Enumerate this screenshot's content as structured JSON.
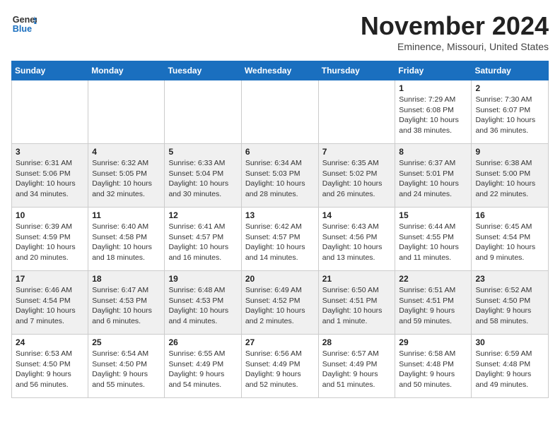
{
  "logo": {
    "line1": "General",
    "line2": "Blue"
  },
  "title": "November 2024",
  "location": "Eminence, Missouri, United States",
  "weekdays": [
    "Sunday",
    "Monday",
    "Tuesday",
    "Wednesday",
    "Thursday",
    "Friday",
    "Saturday"
  ],
  "weeks": [
    [
      {
        "day": "",
        "info": ""
      },
      {
        "day": "",
        "info": ""
      },
      {
        "day": "",
        "info": ""
      },
      {
        "day": "",
        "info": ""
      },
      {
        "day": "",
        "info": ""
      },
      {
        "day": "1",
        "info": "Sunrise: 7:29 AM\nSunset: 6:08 PM\nDaylight: 10 hours\nand 38 minutes."
      },
      {
        "day": "2",
        "info": "Sunrise: 7:30 AM\nSunset: 6:07 PM\nDaylight: 10 hours\nand 36 minutes."
      }
    ],
    [
      {
        "day": "3",
        "info": "Sunrise: 6:31 AM\nSunset: 5:06 PM\nDaylight: 10 hours\nand 34 minutes."
      },
      {
        "day": "4",
        "info": "Sunrise: 6:32 AM\nSunset: 5:05 PM\nDaylight: 10 hours\nand 32 minutes."
      },
      {
        "day": "5",
        "info": "Sunrise: 6:33 AM\nSunset: 5:04 PM\nDaylight: 10 hours\nand 30 minutes."
      },
      {
        "day": "6",
        "info": "Sunrise: 6:34 AM\nSunset: 5:03 PM\nDaylight: 10 hours\nand 28 minutes."
      },
      {
        "day": "7",
        "info": "Sunrise: 6:35 AM\nSunset: 5:02 PM\nDaylight: 10 hours\nand 26 minutes."
      },
      {
        "day": "8",
        "info": "Sunrise: 6:37 AM\nSunset: 5:01 PM\nDaylight: 10 hours\nand 24 minutes."
      },
      {
        "day": "9",
        "info": "Sunrise: 6:38 AM\nSunset: 5:00 PM\nDaylight: 10 hours\nand 22 minutes."
      }
    ],
    [
      {
        "day": "10",
        "info": "Sunrise: 6:39 AM\nSunset: 4:59 PM\nDaylight: 10 hours\nand 20 minutes."
      },
      {
        "day": "11",
        "info": "Sunrise: 6:40 AM\nSunset: 4:58 PM\nDaylight: 10 hours\nand 18 minutes."
      },
      {
        "day": "12",
        "info": "Sunrise: 6:41 AM\nSunset: 4:57 PM\nDaylight: 10 hours\nand 16 minutes."
      },
      {
        "day": "13",
        "info": "Sunrise: 6:42 AM\nSunset: 4:57 PM\nDaylight: 10 hours\nand 14 minutes."
      },
      {
        "day": "14",
        "info": "Sunrise: 6:43 AM\nSunset: 4:56 PM\nDaylight: 10 hours\nand 13 minutes."
      },
      {
        "day": "15",
        "info": "Sunrise: 6:44 AM\nSunset: 4:55 PM\nDaylight: 10 hours\nand 11 minutes."
      },
      {
        "day": "16",
        "info": "Sunrise: 6:45 AM\nSunset: 4:54 PM\nDaylight: 10 hours\nand 9 minutes."
      }
    ],
    [
      {
        "day": "17",
        "info": "Sunrise: 6:46 AM\nSunset: 4:54 PM\nDaylight: 10 hours\nand 7 minutes."
      },
      {
        "day": "18",
        "info": "Sunrise: 6:47 AM\nSunset: 4:53 PM\nDaylight: 10 hours\nand 6 minutes."
      },
      {
        "day": "19",
        "info": "Sunrise: 6:48 AM\nSunset: 4:53 PM\nDaylight: 10 hours\nand 4 minutes."
      },
      {
        "day": "20",
        "info": "Sunrise: 6:49 AM\nSunset: 4:52 PM\nDaylight: 10 hours\nand 2 minutes."
      },
      {
        "day": "21",
        "info": "Sunrise: 6:50 AM\nSunset: 4:51 PM\nDaylight: 10 hours\nand 1 minute."
      },
      {
        "day": "22",
        "info": "Sunrise: 6:51 AM\nSunset: 4:51 PM\nDaylight: 9 hours\nand 59 minutes."
      },
      {
        "day": "23",
        "info": "Sunrise: 6:52 AM\nSunset: 4:50 PM\nDaylight: 9 hours\nand 58 minutes."
      }
    ],
    [
      {
        "day": "24",
        "info": "Sunrise: 6:53 AM\nSunset: 4:50 PM\nDaylight: 9 hours\nand 56 minutes."
      },
      {
        "day": "25",
        "info": "Sunrise: 6:54 AM\nSunset: 4:50 PM\nDaylight: 9 hours\nand 55 minutes."
      },
      {
        "day": "26",
        "info": "Sunrise: 6:55 AM\nSunset: 4:49 PM\nDaylight: 9 hours\nand 54 minutes."
      },
      {
        "day": "27",
        "info": "Sunrise: 6:56 AM\nSunset: 4:49 PM\nDaylight: 9 hours\nand 52 minutes."
      },
      {
        "day": "28",
        "info": "Sunrise: 6:57 AM\nSunset: 4:49 PM\nDaylight: 9 hours\nand 51 minutes."
      },
      {
        "day": "29",
        "info": "Sunrise: 6:58 AM\nSunset: 4:48 PM\nDaylight: 9 hours\nand 50 minutes."
      },
      {
        "day": "30",
        "info": "Sunrise: 6:59 AM\nSunset: 4:48 PM\nDaylight: 9 hours\nand 49 minutes."
      }
    ]
  ]
}
